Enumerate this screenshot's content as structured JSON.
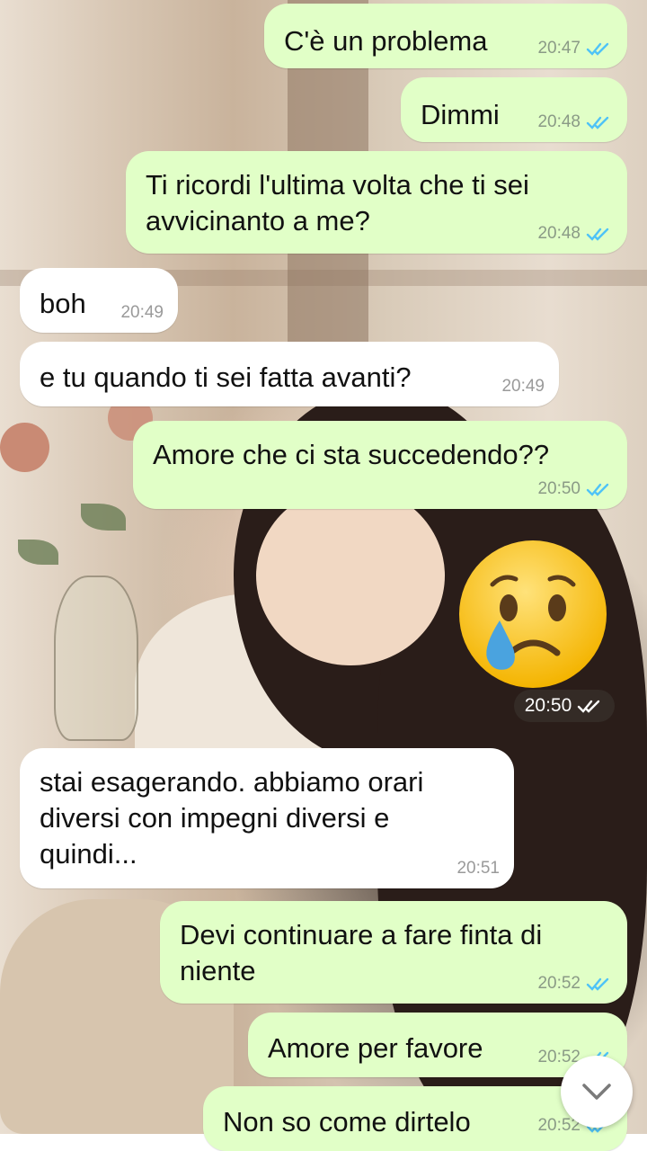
{
  "chat": {
    "messages": [
      {
        "text": "C'è un problema",
        "time": "20:47",
        "direction": "outgoing",
        "status": "read"
      },
      {
        "text": "Dimmi",
        "time": "20:48",
        "direction": "outgoing",
        "status": "read"
      },
      {
        "text": "Ti ricordi l'ultima volta che ti sei avvicinanto a me?",
        "time": "20:48",
        "direction": "outgoing",
        "status": "read"
      },
      {
        "text": "boh",
        "time": "20:49",
        "direction": "incoming"
      },
      {
        "text": "e tu quando ti sei fatta avanti?",
        "time": "20:49",
        "direction": "incoming"
      },
      {
        "text": "Amore che ci sta succedendo??",
        "time": "20:50",
        "direction": "outgoing",
        "status": "read"
      },
      {
        "text": "",
        "emoji": "crying-face",
        "time": "20:50",
        "direction": "outgoing",
        "status": "read"
      },
      {
        "text": "stai esagerando. abbiamo orari diversi con impegni diversi e quindi...",
        "time": "20:51",
        "direction": "incoming"
      },
      {
        "text": "Devi continuare a fare finta di niente",
        "time": "20:52",
        "direction": "outgoing",
        "status": "read"
      },
      {
        "text": "Amore per favore",
        "time": "20:52",
        "direction": "outgoing",
        "status": "read"
      },
      {
        "text": "Non so come dirtelo",
        "time": "20:52",
        "direction": "outgoing",
        "status": "read"
      }
    ]
  },
  "colors": {
    "outgoing_bubble": "#e1ffc7",
    "incoming_bubble": "#ffffff",
    "read_ticks": "#4fc3f7"
  },
  "icons": {
    "read_receipt": "double-check-icon",
    "scroll_down": "chevron-down-icon"
  }
}
